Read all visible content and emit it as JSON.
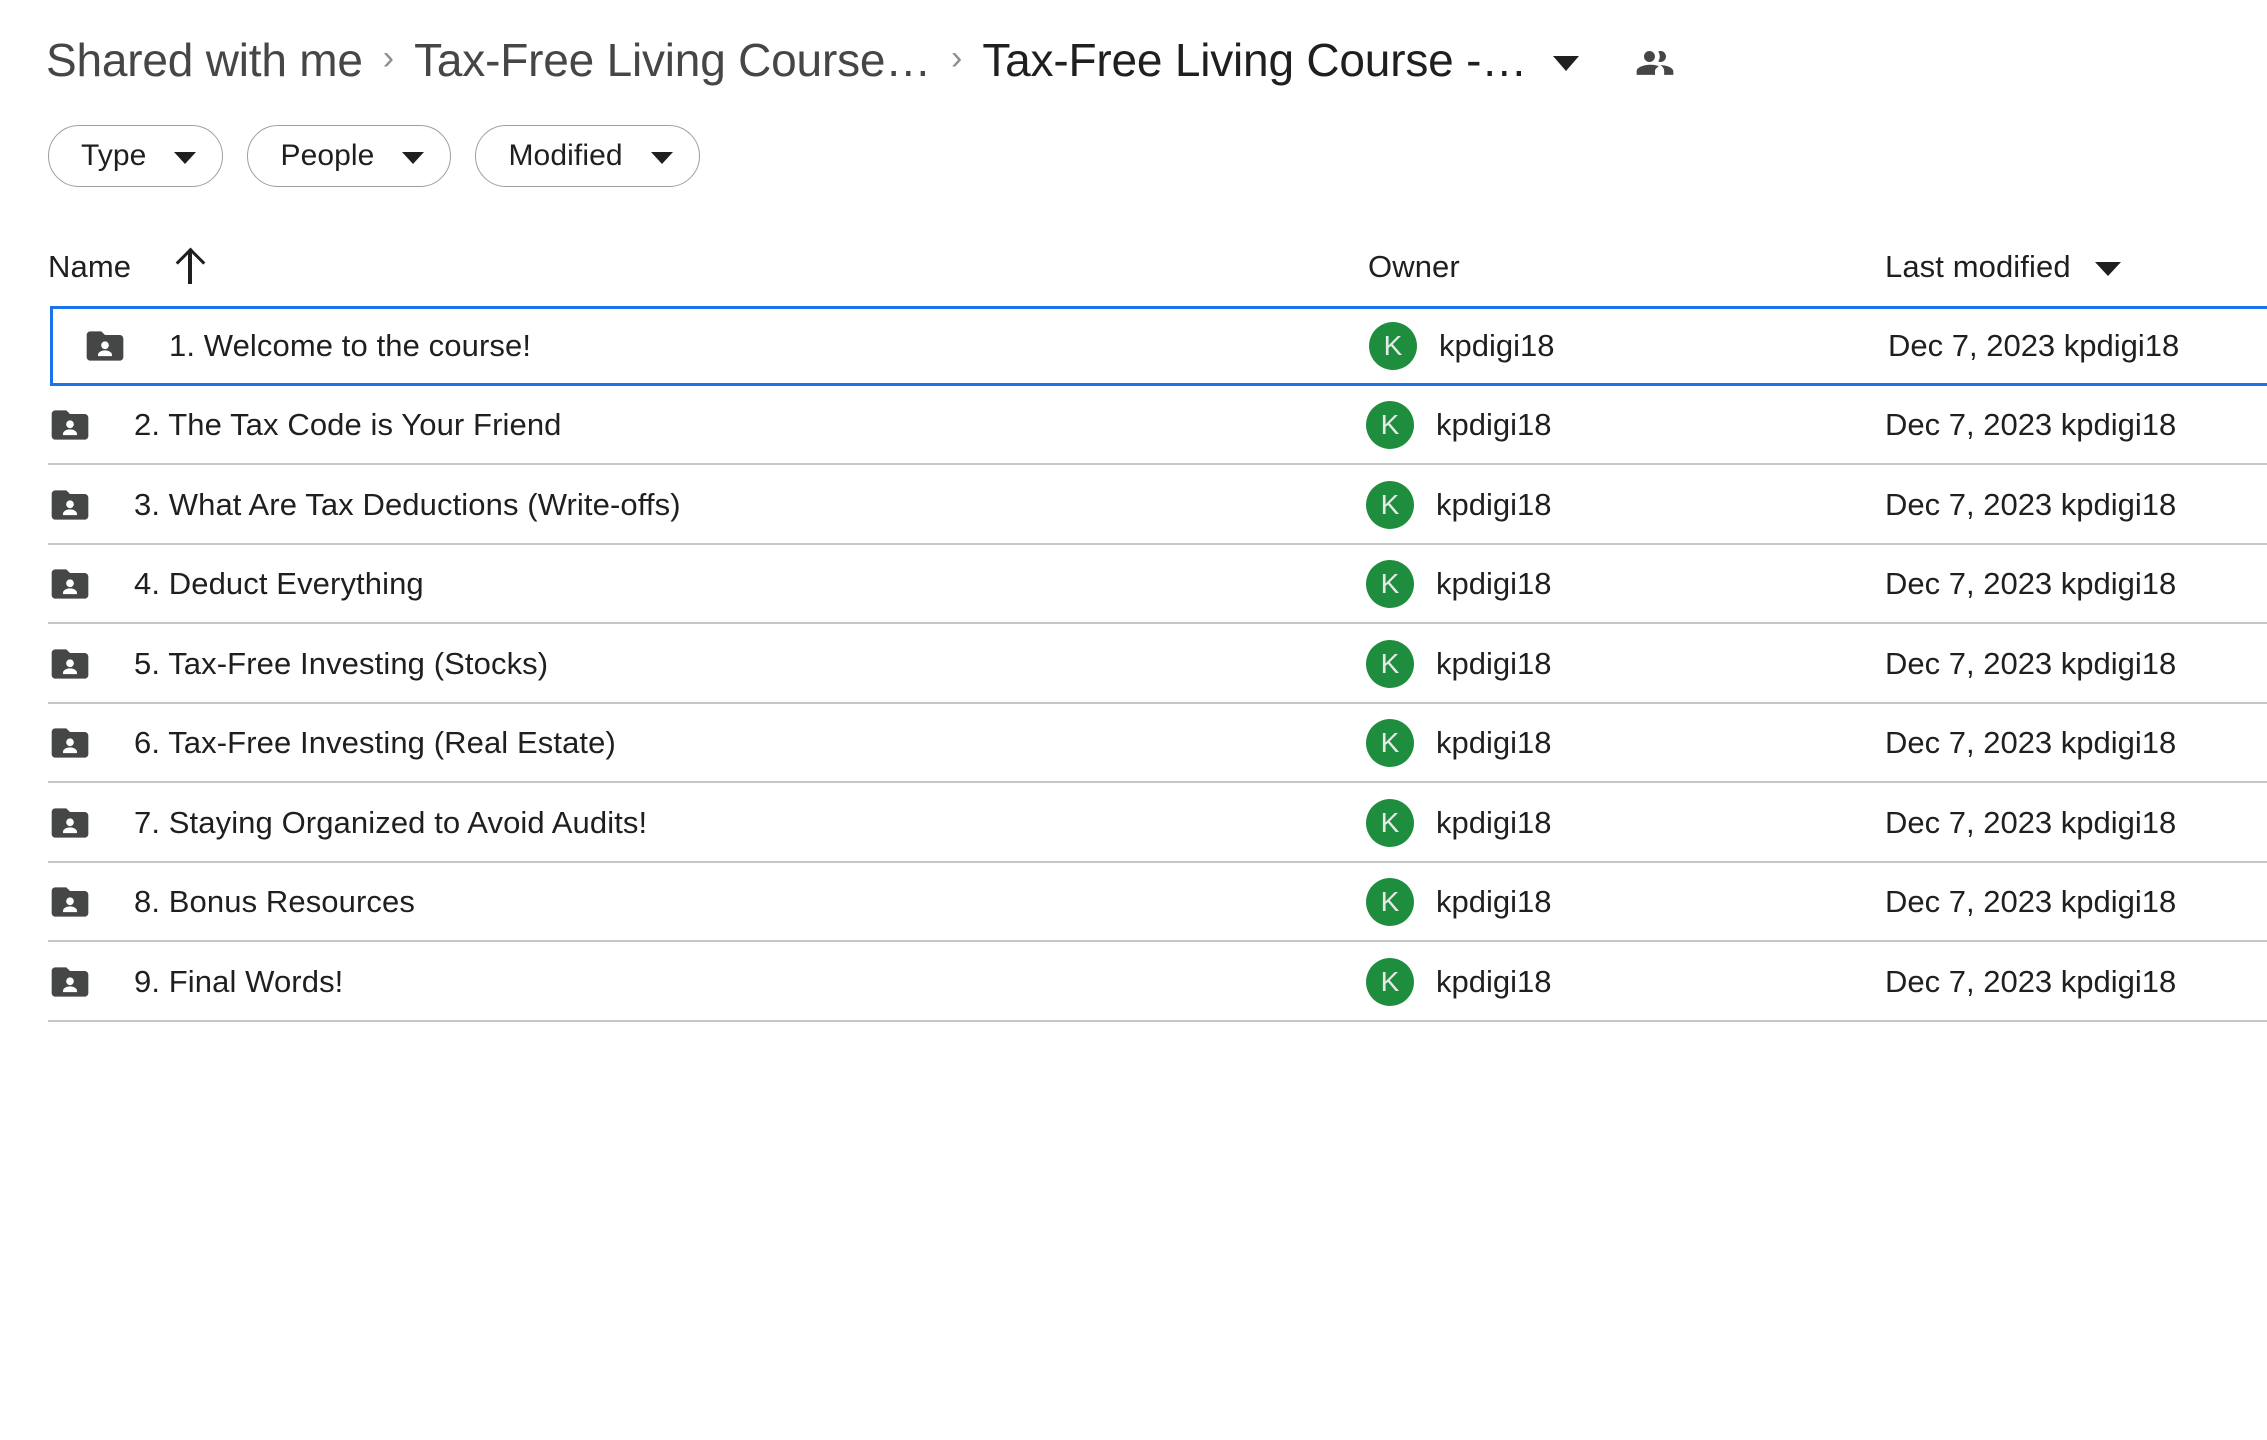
{
  "breadcrumb": {
    "separator": "›",
    "items": [
      {
        "label": "Shared with me"
      },
      {
        "label": "Tax-Free Living Course…"
      },
      {
        "label": "Tax-Free Living Course -…"
      }
    ],
    "caret_icon": "chevron-down-icon",
    "people_icon": "people-shared-icon"
  },
  "filters": [
    {
      "label": "Type",
      "icon": "chevron-down-icon"
    },
    {
      "label": "People",
      "icon": "chevron-down-icon"
    },
    {
      "label": "Modified",
      "icon": "chevron-down-icon"
    }
  ],
  "columns": {
    "name": "Name",
    "name_sort_icon": "arrow-up-icon",
    "owner": "Owner",
    "modified": "Last modified",
    "modified_sort_icon": "triangle-down-icon"
  },
  "colors": {
    "avatar_green": "#1e8e3e",
    "selection_blue": "#1a73e8",
    "folder_gray": "#444746",
    "divider": "#c7c7c7"
  },
  "rows": [
    {
      "icon": "shared-folder-icon",
      "name": "1. Welcome to the course!",
      "owner_initial": "K",
      "owner": "kpdigi18",
      "modified": "Dec 7, 2023 kpdigi18",
      "selected": true
    },
    {
      "icon": "shared-folder-icon",
      "name": "2. The Tax Code is Your Friend",
      "owner_initial": "K",
      "owner": "kpdigi18",
      "modified": "Dec 7, 2023 kpdigi18",
      "selected": false
    },
    {
      "icon": "shared-folder-icon",
      "name": "3. What Are Tax Deductions (Write-offs)",
      "owner_initial": "K",
      "owner": "kpdigi18",
      "modified": "Dec 7, 2023 kpdigi18",
      "selected": false
    },
    {
      "icon": "shared-folder-icon",
      "name": "4. Deduct Everything",
      "owner_initial": "K",
      "owner": "kpdigi18",
      "modified": "Dec 7, 2023 kpdigi18",
      "selected": false
    },
    {
      "icon": "shared-folder-icon",
      "name": "5. Tax-Free Investing (Stocks)",
      "owner_initial": "K",
      "owner": "kpdigi18",
      "modified": "Dec 7, 2023 kpdigi18",
      "selected": false
    },
    {
      "icon": "shared-folder-icon",
      "name": "6. Tax-Free Investing (Real Estate)",
      "owner_initial": "K",
      "owner": "kpdigi18",
      "modified": "Dec 7, 2023 kpdigi18",
      "selected": false
    },
    {
      "icon": "shared-folder-icon",
      "name": "7. Staying Organized to Avoid Audits!",
      "owner_initial": "K",
      "owner": "kpdigi18",
      "modified": "Dec 7, 2023 kpdigi18",
      "selected": false
    },
    {
      "icon": "shared-folder-icon",
      "name": "8. Bonus Resources",
      "owner_initial": "K",
      "owner": "kpdigi18",
      "modified": "Dec 7, 2023 kpdigi18",
      "selected": false
    },
    {
      "icon": "shared-folder-icon",
      "name": "9. Final Words!",
      "owner_initial": "K",
      "owner": "kpdigi18",
      "modified": "Dec 7, 2023 kpdigi18",
      "selected": false
    }
  ]
}
